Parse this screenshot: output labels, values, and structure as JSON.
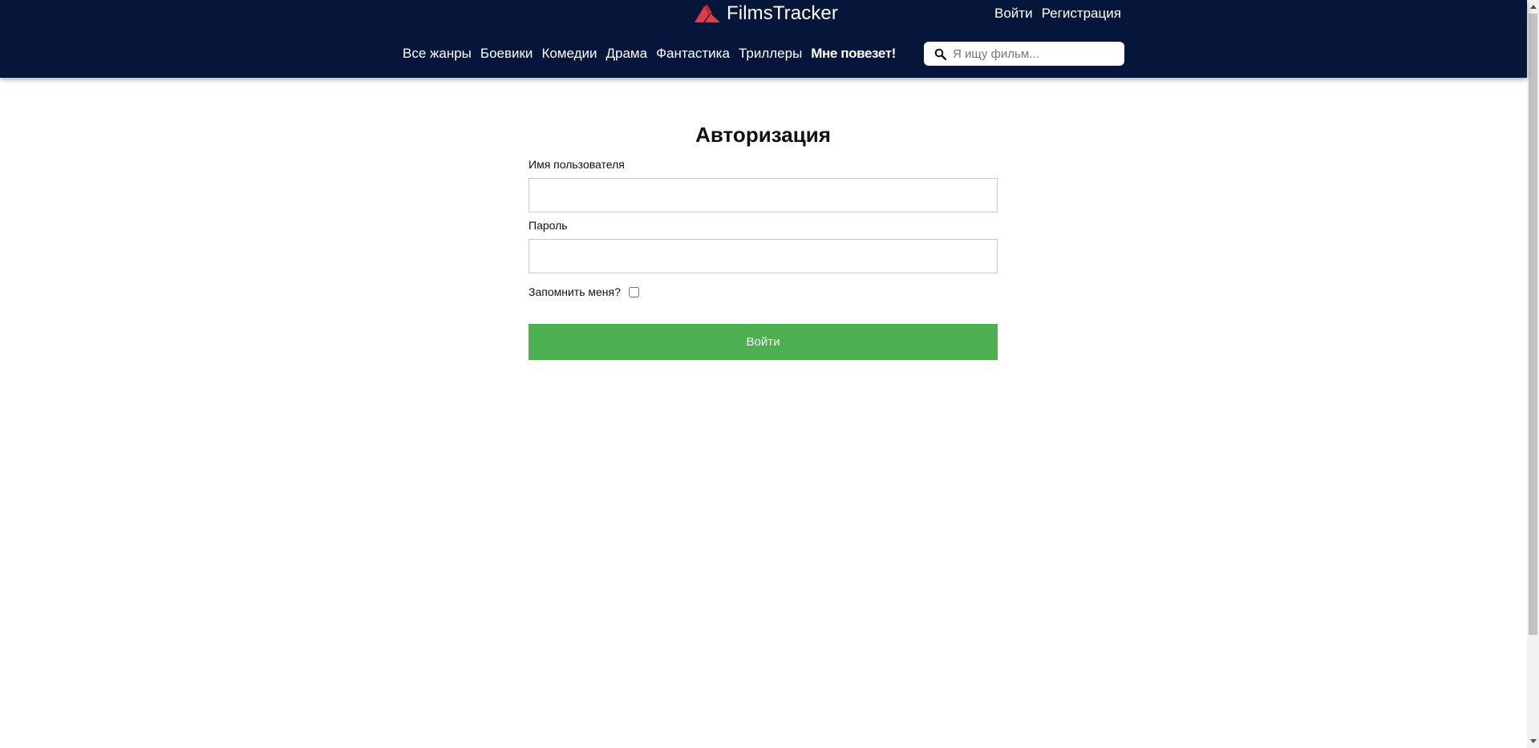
{
  "header": {
    "logo_text": "FilmsTracker",
    "auth": {
      "login_label": "Войти",
      "register_label": "Регистрация"
    },
    "nav": {
      "items": [
        {
          "label": "Все жанры"
        },
        {
          "label": "Боевики"
        },
        {
          "label": "Комедии"
        },
        {
          "label": "Драма"
        },
        {
          "label": "Фантастика"
        },
        {
          "label": "Триллеры"
        },
        {
          "label": "Мне повезет!"
        }
      ]
    },
    "search": {
      "placeholder": "Я ищу фильм...",
      "value": ""
    }
  },
  "login": {
    "title": "Авторизация",
    "username_label": "Имя пользователя",
    "username_value": "",
    "password_label": "Пароль",
    "password_value": "",
    "remember_label": "Запомнить меня?",
    "remember_checked": false,
    "submit_label": "Войти"
  },
  "icons": {
    "logo": "logo-icon",
    "search": "search-icon"
  },
  "colors": {
    "header_bg": "#06163a",
    "logo_red": "#e53945",
    "submit_bg": "#4caf50"
  }
}
